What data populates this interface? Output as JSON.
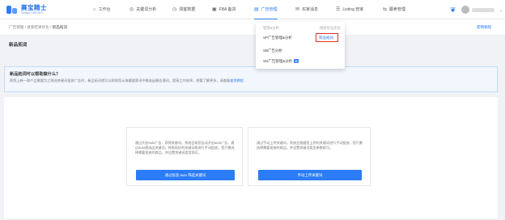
{
  "colors": {
    "accent": "#2b7cf6",
    "highlight_border": "#e03131",
    "info_bg": "#f2f7fe"
  },
  "brand": {
    "name": "赛宝精士",
    "tagline": "SAIBAOJINGSHI"
  },
  "nav": {
    "items": [
      {
        "label": "工作台",
        "icon": "home-icon"
      },
      {
        "label": "关键词分析",
        "icon": "target-icon"
      },
      {
        "label": "领客数据",
        "icon": "clock-icon"
      },
      {
        "label": "FBA 备货",
        "icon": "box-icon"
      },
      {
        "label": "广告管理",
        "icon": "ad-icon",
        "active": true
      },
      {
        "label": "买家消息",
        "icon": "mail-icon"
      },
      {
        "label": "Listing 管家",
        "icon": "list-icon"
      },
      {
        "label": "跟卖管理",
        "icon": "link-icon"
      }
    ]
  },
  "breadcrumb": {
    "items": [
      "广告管理",
      "/",
      "搜索结果优化",
      "/",
      "新品拓词"
    ],
    "help": "使用教程"
  },
  "page_title": "新品拓词",
  "info": {
    "title": "新品拓词可以帮助做什么？",
    "desc_prefix": "帮您上新一款产品需要为之筛选关键词投放广告时，新品拓词就可以帮助您从海量搜索词中挑选出最佳潜词，提高工作效率。想要了解更多，请查看",
    "desc_link": "使用教程"
  },
  "cards": [
    {
      "text": "通过开启auto广告，获得关键词。系统会帮您自动开启auto广告，通过auto筛选出关键词，将表现好的关键词再进行手动投放，您只需选择需要投放的商品，并设置关键词类型即可。",
      "button": "通过投放 auto 筛选关键词"
    },
    {
      "text": "通过手动上传关键词，系统会根据您上传的关键词进行手动投放，您只需选择需要投放的商品，并设置关键词类型参数即可。",
      "button": "手动上传关键词"
    }
  ],
  "dropdown": {
    "col1_head": "管理&分析",
    "col2_head": "搜索优化优化",
    "col1_items": [
      "SP广告管理&分析",
      "SB广告分析",
      "SD广告管理&分析"
    ],
    "col1_badge": "新",
    "col2_items": [
      "新品拓词"
    ]
  }
}
